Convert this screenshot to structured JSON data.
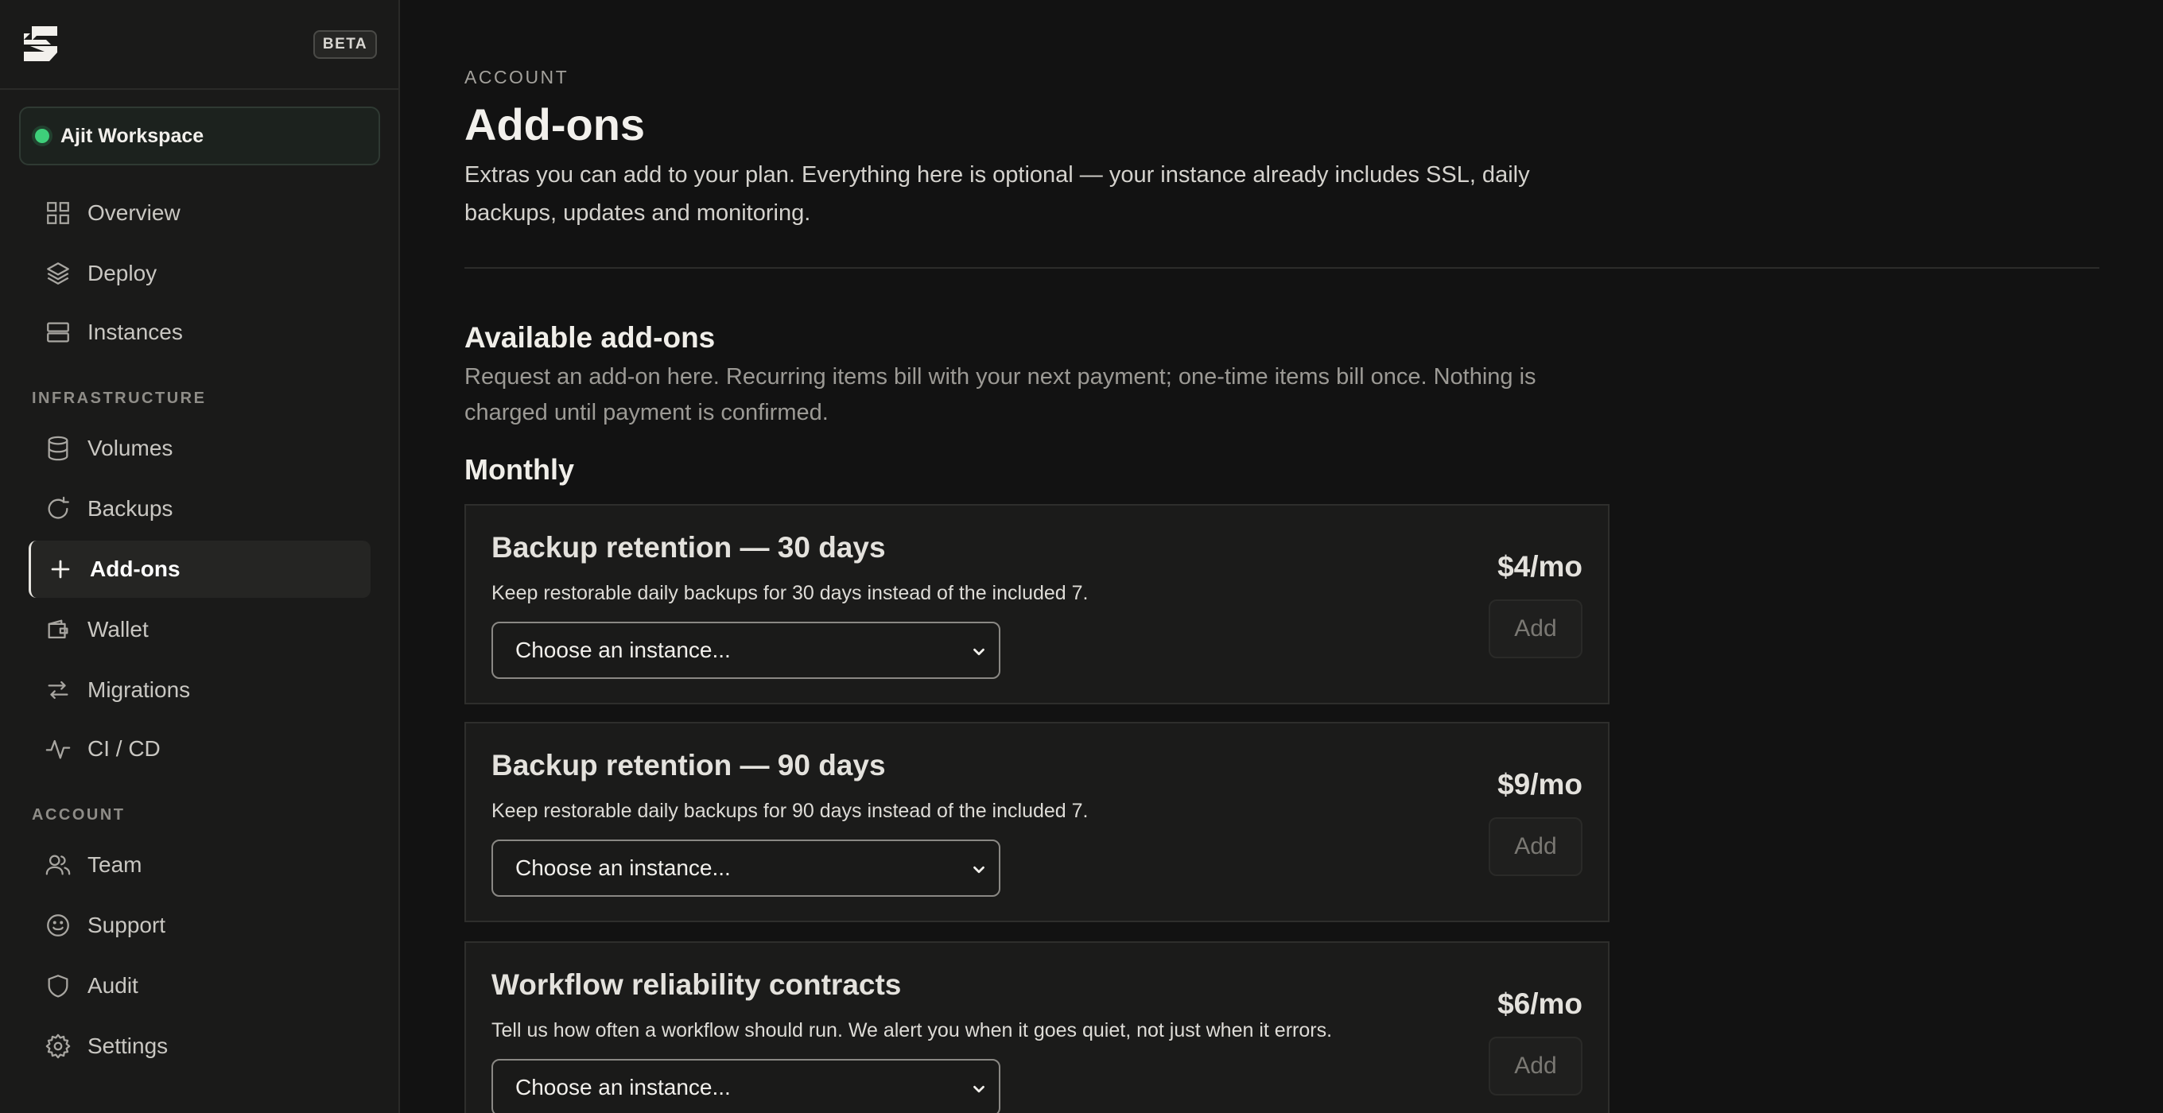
{
  "sidebar": {
    "beta_label": "BETA",
    "workspace": {
      "name": "Ajit Workspace",
      "status_color": "#3ecf7a"
    },
    "sections": {
      "infrastructure": "INFRASTRUCTURE",
      "account": "ACCOUNT"
    },
    "items": [
      {
        "label": "Overview",
        "icon": "grid-icon"
      },
      {
        "label": "Deploy",
        "icon": "layers-icon"
      },
      {
        "label": "Instances",
        "icon": "server-icon"
      },
      {
        "label": "Volumes",
        "icon": "database-icon"
      },
      {
        "label": "Backups",
        "icon": "refresh-icon"
      },
      {
        "label": "Add-ons",
        "icon": "plus-icon",
        "active": true
      },
      {
        "label": "Wallet",
        "icon": "wallet-icon"
      },
      {
        "label": "Migrations",
        "icon": "arrows-icon"
      },
      {
        "label": "CI / CD",
        "icon": "activity-icon"
      },
      {
        "label": "Team",
        "icon": "users-icon"
      },
      {
        "label": "Support",
        "icon": "smile-icon"
      },
      {
        "label": "Audit",
        "icon": "shield-icon"
      },
      {
        "label": "Settings",
        "icon": "gear-icon"
      }
    ]
  },
  "main": {
    "eyebrow": "ACCOUNT",
    "title": "Add-ons",
    "description": "Extras you can add to your plan. Everything here is optional — your instance already includes SSL, daily backups, updates and monitoring.",
    "section_title": "Available add-ons",
    "section_description": "Request an add-on here. Recurring items bill with your next payment; one-time items bill once. Nothing is charged until payment is confirmed.",
    "group_title": "Monthly",
    "cards": [
      {
        "title": "Backup retention — 30 days",
        "description": "Keep restorable daily backups for 30 days instead of the included 7.",
        "select_placeholder": "Choose an instance...",
        "price": "$4/mo",
        "add_label": "Add"
      },
      {
        "title": "Backup retention — 90 days",
        "description": "Keep restorable daily backups for 90 days instead of the included 7.",
        "select_placeholder": "Choose an instance...",
        "price": "$9/mo",
        "add_label": "Add"
      },
      {
        "title": "Workflow reliability contracts",
        "description": "Tell us how often a workflow should run. We alert you when it goes quiet, not just when it errors.",
        "select_placeholder": "Choose an instance...",
        "price": "$6/mo",
        "add_label": "Add"
      }
    ]
  },
  "colors": {
    "background": "#121212",
    "sidebar": "#1a1a19",
    "accent_green": "#3ecf7a",
    "card": "#1b1b1a"
  }
}
